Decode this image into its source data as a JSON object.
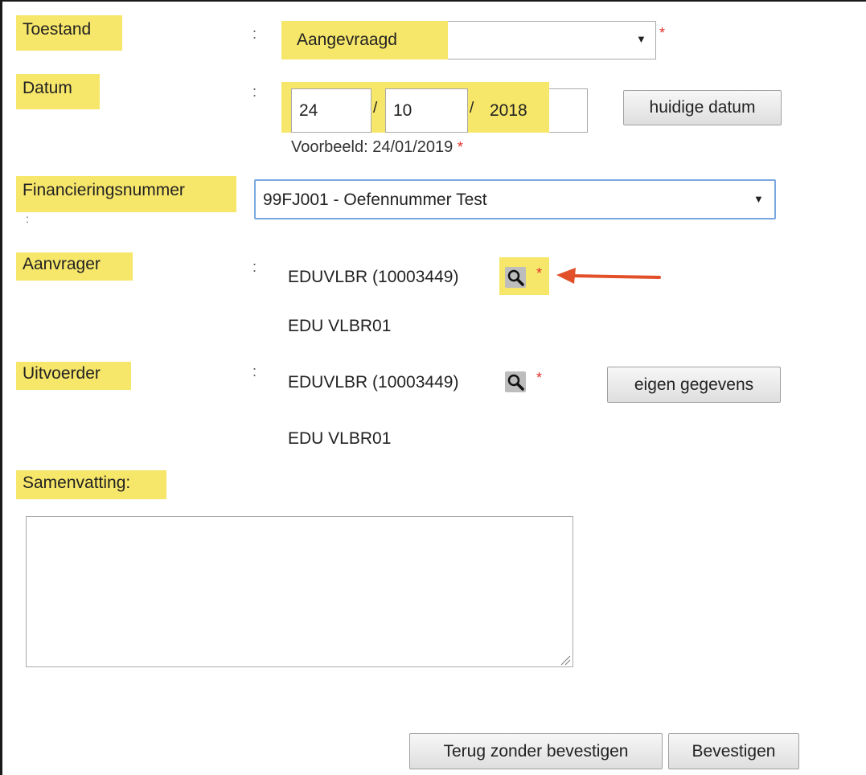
{
  "form": {
    "toestand": {
      "label": "Toestand",
      "colon": ":",
      "value": "Aangevraagd",
      "required": "*"
    },
    "datum": {
      "label": "Datum",
      "colon": ":",
      "day": "24",
      "month": "10",
      "year": "2018",
      "separator": "/",
      "today_button": "huidige datum",
      "example": "Voorbeeld: 24/01/2019",
      "required": "*"
    },
    "financieringsnummer": {
      "label": "Financieringsnummer",
      "colon": ":",
      "value": "99FJ001 - Oefennummer Test"
    },
    "aanvrager": {
      "label": "Aanvrager",
      "colon": ":",
      "code": "EDUVLBR (10003449)",
      "name": "EDU VLBR01",
      "required": "*"
    },
    "uitvoerder": {
      "label": "Uitvoerder",
      "colon": ":",
      "code": "EDUVLBR (10003449)",
      "name": "EDU VLBR01",
      "required": "*",
      "own_data_button": "eigen gegevens"
    },
    "samenvatting": {
      "label": "Samenvatting:",
      "value": ""
    }
  },
  "footer": {
    "back_button": "Terug zonder bevestigen",
    "confirm_button": "Bevestigen"
  },
  "icons": {
    "dropdown": "chevron-down-icon",
    "lookup": "search-icon",
    "pointer": "arrow-left-icon"
  },
  "colors": {
    "highlight": "#f6e66a",
    "required": "#e0302a",
    "arrow": "#e2502a",
    "focus_border": "#7aa7e0"
  }
}
